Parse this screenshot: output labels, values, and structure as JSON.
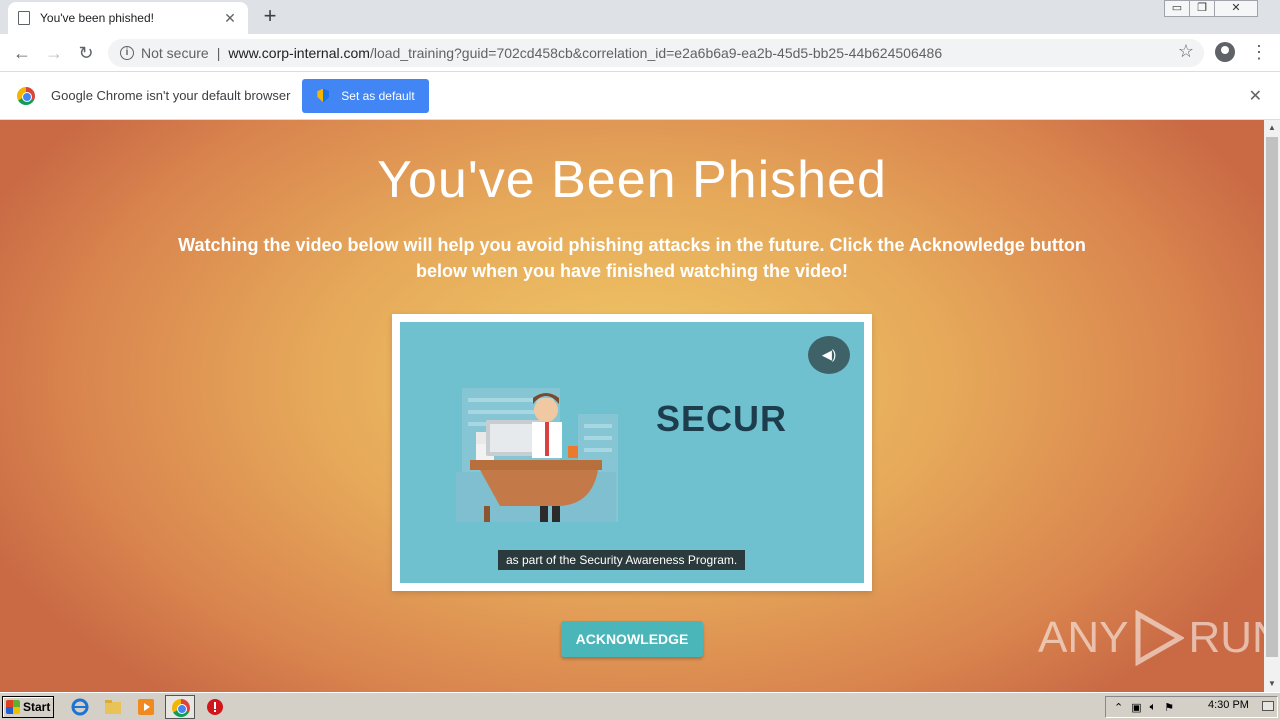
{
  "browser": {
    "tab_title": "You've been phished!",
    "tab_close": "✕",
    "new_tab": "+",
    "win_controls": {
      "minimize": "▭",
      "restore": "❐",
      "close": "✕"
    },
    "nav": {
      "back": "←",
      "forward": "→",
      "reload": "↻",
      "menu": "⋮"
    },
    "address": {
      "security_label": "Not secure",
      "separator": "|",
      "host": "www.corp-internal.com",
      "path": "/load_training?guid=702cd458cb&correlation_id=e2a6b6a9-ea2b-45d5-bb25-44b624506486",
      "bookmark": "☆"
    },
    "infobar": {
      "message": "Google Chrome isn't your default browser",
      "button": "Set as default",
      "close": "✕"
    }
  },
  "page": {
    "heading": "You've Been Phished",
    "subtext": "Watching the video below will help you avoid phishing attacks in the future. Click the Acknowledge button below when you have finished watching the video!",
    "video": {
      "mute_icon": "◀)",
      "title_text": "SECUR",
      "caption": "as part of the Security Awareness Program."
    },
    "acknowledge_button": "ACKNOWLEDGE",
    "watermark": {
      "left": "ANY",
      "right": "RUN"
    }
  },
  "taskbar": {
    "start": "Start",
    "clock": "4:30 PM"
  }
}
